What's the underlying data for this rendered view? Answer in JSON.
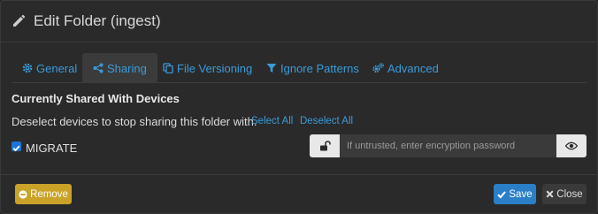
{
  "modal": {
    "title": "Edit Folder (ingest)"
  },
  "tabs": [
    {
      "label": "General",
      "icon": "gear-icon"
    },
    {
      "label": "Sharing",
      "icon": "share-icon",
      "active": true
    },
    {
      "label": "File Versioning",
      "icon": "copy-icon"
    },
    {
      "label": "Ignore Patterns",
      "icon": "filter-icon"
    },
    {
      "label": "Advanced",
      "icon": "cogs-icon"
    }
  ],
  "sharing": {
    "section_title": "Currently Shared With Devices",
    "hint": "Deselect devices to stop sharing this folder with.",
    "select_all": "Select All",
    "deselect_all": "Deselect All",
    "devices": [
      {
        "name": "MIGRATE",
        "checked": true,
        "encryption_placeholder": "If untrusted, enter encryption password"
      }
    ]
  },
  "footer": {
    "remove_label": "Remove",
    "save_label": "Save",
    "close_label": "Close"
  },
  "colors": {
    "accent": "#3a9bd9",
    "remove": "#c9a227",
    "save": "#2a7fc7",
    "background": "#2a2a2a"
  }
}
